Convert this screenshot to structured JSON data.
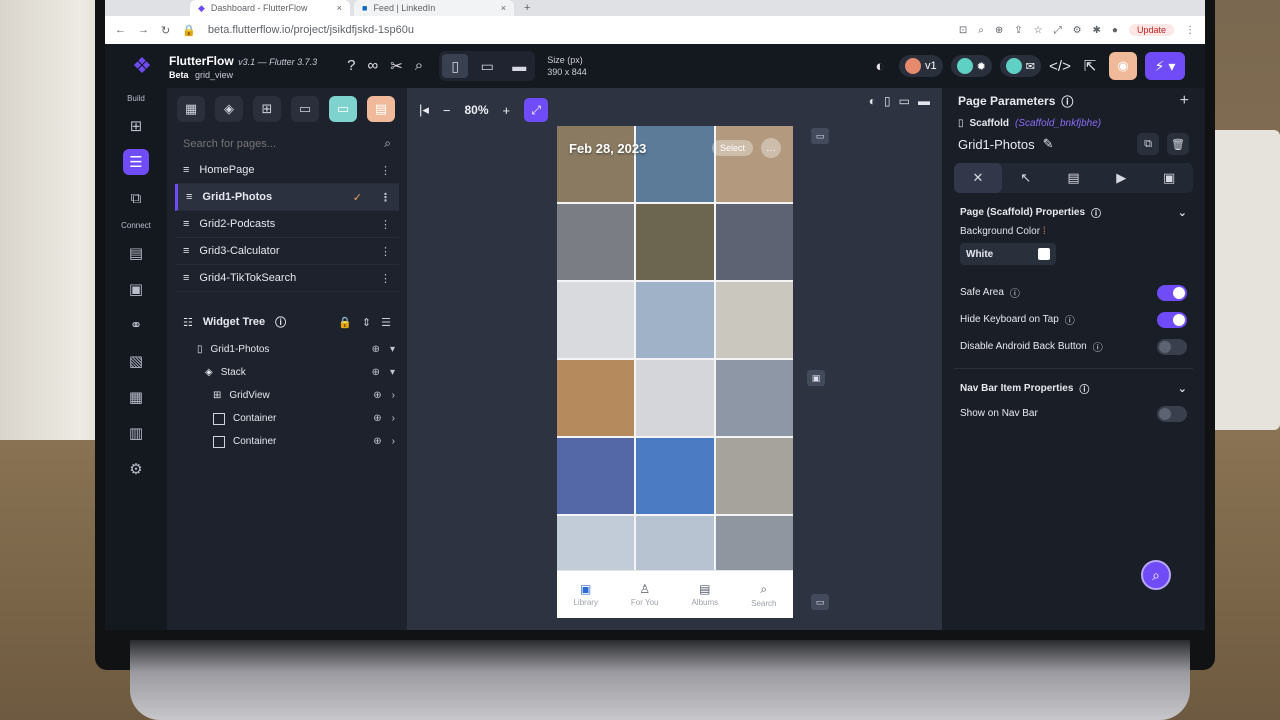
{
  "browser": {
    "tabs": [
      {
        "label": "Dashboard - FlutterFlow",
        "icon": "flutterflow-favicon"
      },
      {
        "label": "Feed | LinkedIn",
        "icon": "linkedin-favicon"
      }
    ],
    "url": "beta.flutterflow.io/project/jsikdfjskd-1sp60u",
    "update_label": "Update"
  },
  "toolbar": {
    "app_name": "FlutterFlow",
    "version": "v3.1 — Flutter 3.7.3",
    "beta_label": "Beta",
    "page_label": "grid_view",
    "size_label": "Size (px)",
    "size_value": "390 x 844",
    "version_pill": "v1"
  },
  "rail": {
    "build_label": "Build",
    "connect_label": "Connect"
  },
  "pages_panel": {
    "search_placeholder": "Search for pages...",
    "pages": [
      {
        "label": "HomePage",
        "selected": false
      },
      {
        "label": "Grid1-Photos",
        "selected": true
      },
      {
        "label": "Grid2-Podcasts",
        "selected": false
      },
      {
        "label": "Grid3-Calculator",
        "selected": false
      },
      {
        "label": "Grid4-TikTokSearch",
        "selected": false
      }
    ]
  },
  "widget_tree": {
    "title": "Widget Tree",
    "nodes": [
      {
        "label": "Grid1-Photos",
        "icon": "phone-icon"
      },
      {
        "label": "Stack",
        "icon": "stack-icon"
      },
      {
        "label": "GridView",
        "icon": "grid-icon"
      },
      {
        "label": "Container",
        "icon": "container-icon"
      },
      {
        "label": "Container",
        "icon": "container-icon"
      }
    ]
  },
  "canvas": {
    "zoom": "80%",
    "phone": {
      "date": "Feb 28, 2023",
      "select_label": "Select",
      "nav": [
        {
          "label": "Library",
          "icon": "photo-library-icon",
          "active": true
        },
        {
          "label": "For You",
          "icon": "person-icon",
          "active": false
        },
        {
          "label": "Albums",
          "icon": "album-icon",
          "active": false
        },
        {
          "label": "Search",
          "icon": "search-icon",
          "active": false
        }
      ],
      "tiles": [
        "#8a7a62",
        "#5b7b99",
        "#b39a7e",
        "#7b7d84",
        "#6c6650",
        "#5d6372",
        "#d9dadd",
        "#9fb2c8",
        "#c9c7be",
        "#b58b5e",
        "#d4d6da",
        "#8e97a5",
        "#5468a8",
        "#4b7bc2",
        "#a6a29c",
        "#c2ccd8",
        "#b7c3d0",
        "#8f96a0"
      ]
    }
  },
  "props": {
    "title": "Page Parameters",
    "scaffold_label": "Scaffold",
    "scaffold_id": "(Scaffold_bnkfjbhe)",
    "page_name": "Grid1-Photos",
    "section_title": "Page (Scaffold) Properties",
    "bg_color_label": "Background Color",
    "bg_color_value": "White",
    "toggles": [
      {
        "label": "Safe Area",
        "on": true
      },
      {
        "label": "Hide Keyboard on Tap",
        "on": true
      },
      {
        "label": "Disable Android Back Button",
        "on": false
      }
    ],
    "nav_section_title": "Nav Bar Item Properties",
    "show_nav_label": "Show on Nav Bar"
  },
  "colors": {
    "accent": "#6f4cf7",
    "panel": "#1e222c",
    "canvas": "#2e3341"
  }
}
